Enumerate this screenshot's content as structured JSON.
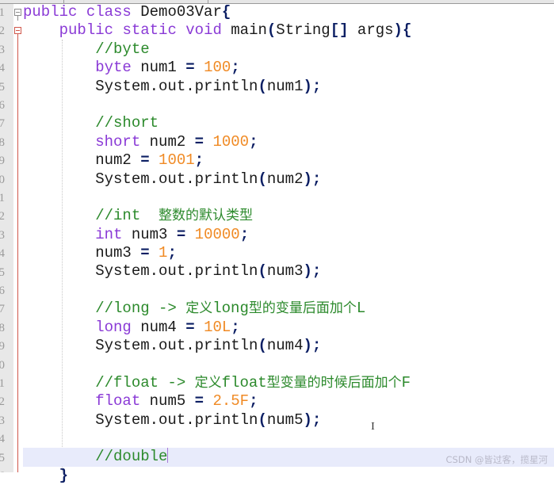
{
  "editor": {
    "language": "java",
    "current_line": 25,
    "gutter_line_numbers": [
      "1",
      "2",
      "3",
      "4",
      "5",
      "6",
      "7",
      "8",
      "9",
      "0",
      "1",
      "2",
      "3",
      "4",
      "5",
      "6",
      "7",
      "8",
      "9",
      "0",
      "1",
      "2",
      "3",
      "4",
      "5",
      "6"
    ],
    "lines": [
      [
        {
          "t": "public",
          "c": "kw"
        },
        {
          "t": " "
        },
        {
          "t": "class",
          "c": "kw"
        },
        {
          "t": " Demo03Var"
        },
        {
          "t": "{",
          "c": "op"
        }
      ],
      [
        {
          "t": "    "
        },
        {
          "t": "public",
          "c": "kw"
        },
        {
          "t": " "
        },
        {
          "t": "static",
          "c": "kw"
        },
        {
          "t": " "
        },
        {
          "t": "void",
          "c": "kw"
        },
        {
          "t": " main"
        },
        {
          "t": "(",
          "c": "op"
        },
        {
          "t": "String"
        },
        {
          "t": "[]",
          "c": "op"
        },
        {
          "t": " args"
        },
        {
          "t": ")",
          "c": "op"
        },
        {
          "t": "{",
          "c": "op"
        }
      ],
      [
        {
          "t": "        "
        },
        {
          "t": "//byte",
          "c": "cm"
        }
      ],
      [
        {
          "t": "        "
        },
        {
          "t": "byte",
          "c": "kw"
        },
        {
          "t": " num1 "
        },
        {
          "t": "=",
          "c": "op"
        },
        {
          "t": " "
        },
        {
          "t": "100",
          "c": "num"
        },
        {
          "t": ";",
          "c": "op"
        }
      ],
      [
        {
          "t": "        System.out.println"
        },
        {
          "t": "(",
          "c": "op"
        },
        {
          "t": "num1"
        },
        {
          "t": ")",
          "c": "op"
        },
        {
          "t": ";",
          "c": "op"
        }
      ],
      [],
      [
        {
          "t": "        "
        },
        {
          "t": "//short",
          "c": "cm"
        }
      ],
      [
        {
          "t": "        "
        },
        {
          "t": "short",
          "c": "kw"
        },
        {
          "t": " num2 "
        },
        {
          "t": "=",
          "c": "op"
        },
        {
          "t": " "
        },
        {
          "t": "1000",
          "c": "num"
        },
        {
          "t": ";",
          "c": "op"
        }
      ],
      [
        {
          "t": "        num2 "
        },
        {
          "t": "=",
          "c": "op"
        },
        {
          "t": " "
        },
        {
          "t": "1001",
          "c": "num"
        },
        {
          "t": ";",
          "c": "op"
        }
      ],
      [
        {
          "t": "        System.out.println"
        },
        {
          "t": "(",
          "c": "op"
        },
        {
          "t": "num2"
        },
        {
          "t": ")",
          "c": "op"
        },
        {
          "t": ";",
          "c": "op"
        }
      ],
      [],
      [
        {
          "t": "        "
        },
        {
          "t": "//int  ",
          "c": "cm"
        },
        {
          "t": "整数的默认类型",
          "c": "cjk"
        }
      ],
      [
        {
          "t": "        "
        },
        {
          "t": "int",
          "c": "kw"
        },
        {
          "t": " num3 "
        },
        {
          "t": "=",
          "c": "op"
        },
        {
          "t": " "
        },
        {
          "t": "10000",
          "c": "num"
        },
        {
          "t": ";",
          "c": "op"
        }
      ],
      [
        {
          "t": "        num3 "
        },
        {
          "t": "=",
          "c": "op"
        },
        {
          "t": " "
        },
        {
          "t": "1",
          "c": "num"
        },
        {
          "t": ";",
          "c": "op"
        }
      ],
      [
        {
          "t": "        System.out.println"
        },
        {
          "t": "(",
          "c": "op"
        },
        {
          "t": "num3"
        },
        {
          "t": ")",
          "c": "op"
        },
        {
          "t": ";",
          "c": "op"
        }
      ],
      [],
      [
        {
          "t": "        "
        },
        {
          "t": "//long -> ",
          "c": "cm"
        },
        {
          "t": "定义",
          "c": "cjk"
        },
        {
          "t": "long",
          "c": "cm"
        },
        {
          "t": "型的变量后面加个",
          "c": "cjk"
        },
        {
          "t": "L",
          "c": "cm"
        }
      ],
      [
        {
          "t": "        "
        },
        {
          "t": "long",
          "c": "kw"
        },
        {
          "t": " num4 "
        },
        {
          "t": "=",
          "c": "op"
        },
        {
          "t": " "
        },
        {
          "t": "10L",
          "c": "num"
        },
        {
          "t": ";",
          "c": "op"
        }
      ],
      [
        {
          "t": "        System.out.println"
        },
        {
          "t": "(",
          "c": "op"
        },
        {
          "t": "num4"
        },
        {
          "t": ")",
          "c": "op"
        },
        {
          "t": ";",
          "c": "op"
        }
      ],
      [],
      [
        {
          "t": "        "
        },
        {
          "t": "//float -> ",
          "c": "cm"
        },
        {
          "t": "定义",
          "c": "cjk"
        },
        {
          "t": "float",
          "c": "cm"
        },
        {
          "t": "型变量的时候后面加个",
          "c": "cjk"
        },
        {
          "t": "F",
          "c": "cm"
        }
      ],
      [
        {
          "t": "        "
        },
        {
          "t": "float",
          "c": "kw"
        },
        {
          "t": " num5 "
        },
        {
          "t": "=",
          "c": "op"
        },
        {
          "t": " "
        },
        {
          "t": "2.5F",
          "c": "num"
        },
        {
          "t": ";",
          "c": "op"
        }
      ],
      [
        {
          "t": "        System.out.println"
        },
        {
          "t": "(",
          "c": "op"
        },
        {
          "t": "num5"
        },
        {
          "t": ")",
          "c": "op"
        },
        {
          "t": ";",
          "c": "op"
        }
      ],
      [],
      [
        {
          "t": "        "
        },
        {
          "t": "//double",
          "c": "cm"
        }
      ],
      [
        {
          "t": "    "
        },
        {
          "t": "}",
          "c": "op"
        }
      ]
    ]
  },
  "colors": {
    "keyword": "#8a3ad6",
    "number": "#f08a24",
    "comment": "#2c8a2c",
    "operator": "#0b1e63",
    "current_line_bg": "#e8ebfb",
    "fold_marker": "#d0574b"
  },
  "cursor_glyph": "I",
  "watermark": "CSDN @皆过客，揽星河"
}
